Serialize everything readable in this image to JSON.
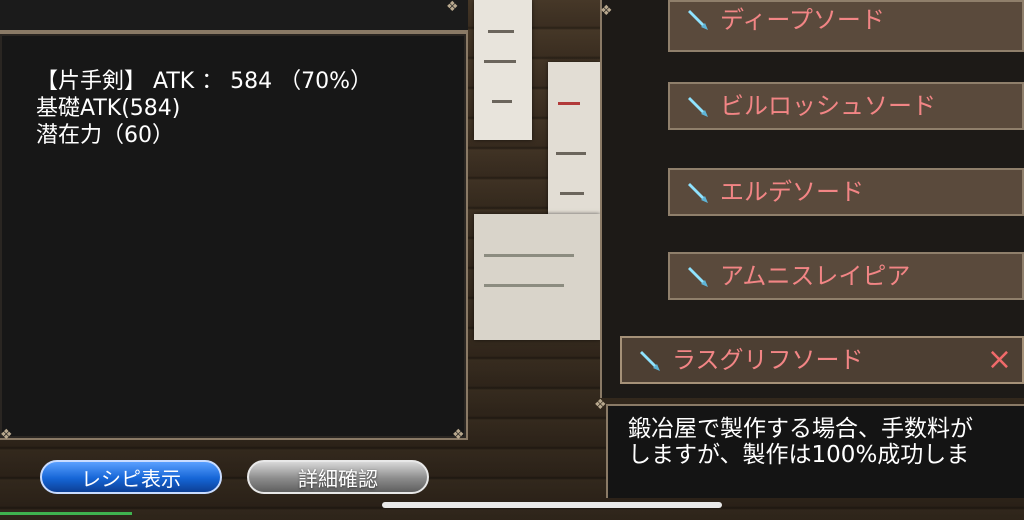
{
  "stats": {
    "line1": "【片手剣】 ATK ： 584 （70%）",
    "line2": "基礎ATK(584)",
    "line3": "潜在力（60）"
  },
  "buttons": {
    "recipe": "レシピ表示",
    "detail": "詳細確認"
  },
  "weapon_list": [
    {
      "name": "ディープソード",
      "selected": false
    },
    {
      "name": "ビルロッシュソード",
      "selected": false
    },
    {
      "name": "エルデソード",
      "selected": false
    },
    {
      "name": "アムニスレイピア",
      "selected": false
    },
    {
      "name": "ラスグリフソード",
      "selected": true
    }
  ],
  "close_symbol": "×",
  "message": {
    "line1": "鍛冶屋で製作する場合、手数料が",
    "line2": "しますが、製作は100%成功しま"
  },
  "colors": {
    "item_text": "#f28585",
    "recipe_button": "#1565d6",
    "detail_button": "#8b8b8b",
    "panel_border": "#8a7a66"
  },
  "icons": {
    "weapon": "sword-icon",
    "close": "close-icon"
  }
}
